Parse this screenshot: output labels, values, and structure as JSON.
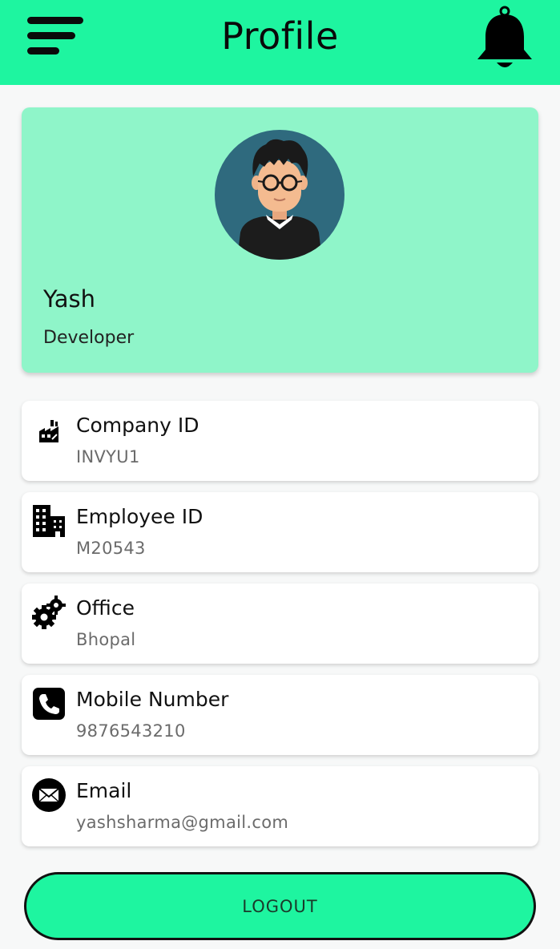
{
  "app_bar": {
    "title": "Profile",
    "menu_icon": "hamburger-menu-icon",
    "notification_icon": "bell-icon",
    "background_color": "#1ef5a0"
  },
  "profile": {
    "name": "Yash",
    "role": "Developer",
    "avatar_icon": "avatar-icon",
    "card_color": "#8ff5c9"
  },
  "details": [
    {
      "icon": "factory-icon",
      "label": "Company ID",
      "value": "INVYU1"
    },
    {
      "icon": "building-icon",
      "label": "Employee ID",
      "value": "M20543"
    },
    {
      "icon": "gears-icon",
      "label": "Office",
      "value": "Bhopal"
    },
    {
      "icon": "phone-icon",
      "label": "Mobile Number",
      "value": "9876543210"
    },
    {
      "icon": "email-icon",
      "label": "Email",
      "value": "yashsharma@gmail.com"
    }
  ],
  "logout": {
    "label": "LOGOUT"
  }
}
